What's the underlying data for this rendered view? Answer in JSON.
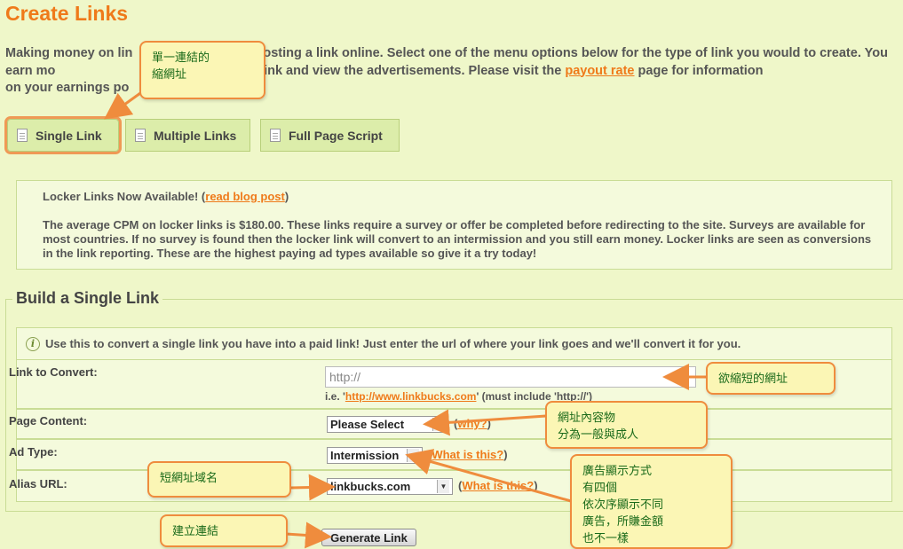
{
  "page": {
    "title": "Create Links",
    "intro_prefix": "Making money on lin",
    "intro_middle": "s posting a link online. Select one of the menu options below for the type of link you would to create. You earn mo",
    "intro_line2": "le visit your link and view the advertisements. Please visit the ",
    "payout_link": "payout rate",
    "intro_suffix": " page for information",
    "intro_line3": "on your earnings po"
  },
  "tabs": [
    {
      "label": "Single Link",
      "icon": "document-icon",
      "active": true
    },
    {
      "label": "Multiple Links",
      "icon": "document-icon",
      "active": false
    },
    {
      "label": "Full Page Script",
      "icon": "document-icon",
      "active": false
    }
  ],
  "notice": {
    "heading": "Locker Links Now Available! (",
    "heading_link": "read blog post",
    "heading_close": ")",
    "body": "The average CPM on locker links is $180.00. These links require a survey or offer be completed before redirecting to the site. Surveys are available for most countries. If no survey is found then the locker link will convert to an intermission and you still earn money. Locker links are seen as conversions in the link reporting. These are the highest paying ad types available so give it a try today!"
  },
  "form": {
    "legend": "Build a Single Link",
    "info_icon": "info-icon",
    "info_text": "Use this to convert a single link you have into a paid link! Just enter the url of where your link goes and we'll convert it for you.",
    "link_label": "Link to Convert:",
    "link_value": "http://",
    "hint_prefix": "i.e. '",
    "hint_link": "http://www.linkbucks.com",
    "hint_suffix": "' (must include 'http://')",
    "content_label": "Page Content:",
    "content_value": "Please Select",
    "content_help_open": "(",
    "content_help": "why?",
    "content_help_close": ")",
    "adtype_label": "Ad Type:",
    "adtype_value": "Intermission",
    "adtype_help_open": "(",
    "adtype_help": "What is this?",
    "adtype_help_close": ")",
    "alias_label": "Alias URL:",
    "alias_value": "linkbucks.com",
    "alias_help_open": "(",
    "alias_help": "What is this?",
    "alias_help_close": ")",
    "generate_label": "Generate Link"
  },
  "callouts": {
    "single_link": "單一連結的\n縮網址",
    "url_to_shorten": "欲縮短的網址",
    "page_content": "網址內容物\n分為一般與成人",
    "ad_type": "廣告顯示方式\n有四個\n依次序顯示不同\n廣告，所賺金額\n也不一樣",
    "alias_domain": "短網址域名",
    "create_link": "建立連結"
  },
  "colors": {
    "background": "#eff7c9",
    "accent": "#ef7a1a",
    "callout_bg": "#fbf6b5",
    "callout_border": "#ef8c3d",
    "callout_text": "#1a6a1a"
  }
}
